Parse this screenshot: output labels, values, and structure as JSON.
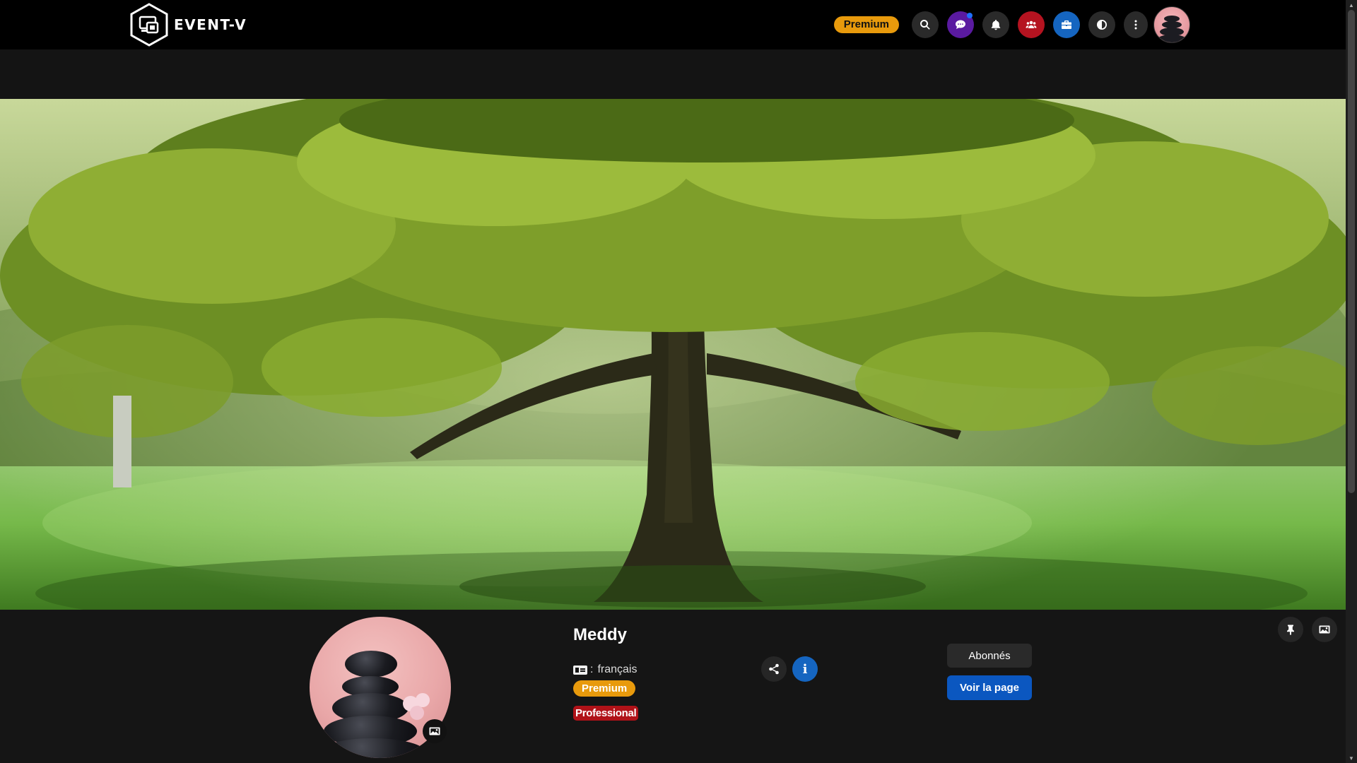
{
  "header": {
    "logo_text": "EVENT-V",
    "premium_label": "Premium",
    "icons": [
      "search-icon",
      "chat-icon",
      "bell-icon",
      "users-icon",
      "briefcase-icon",
      "contrast-icon",
      "more-vertical-icon"
    ]
  },
  "profile": {
    "name": "Meddy",
    "language_separator": ":",
    "language": "français",
    "badge_premium": "Premium",
    "badge_professional": "Professional",
    "info_label": "i",
    "subscribers_button": "Abonnés",
    "view_page_button": "Voir la page"
  },
  "colors": {
    "premium": "#e89a0c",
    "professional": "#b01218",
    "primary_blue": "#0b57c0",
    "chat_purple": "#5a1aa0",
    "users_red": "#b51320"
  }
}
